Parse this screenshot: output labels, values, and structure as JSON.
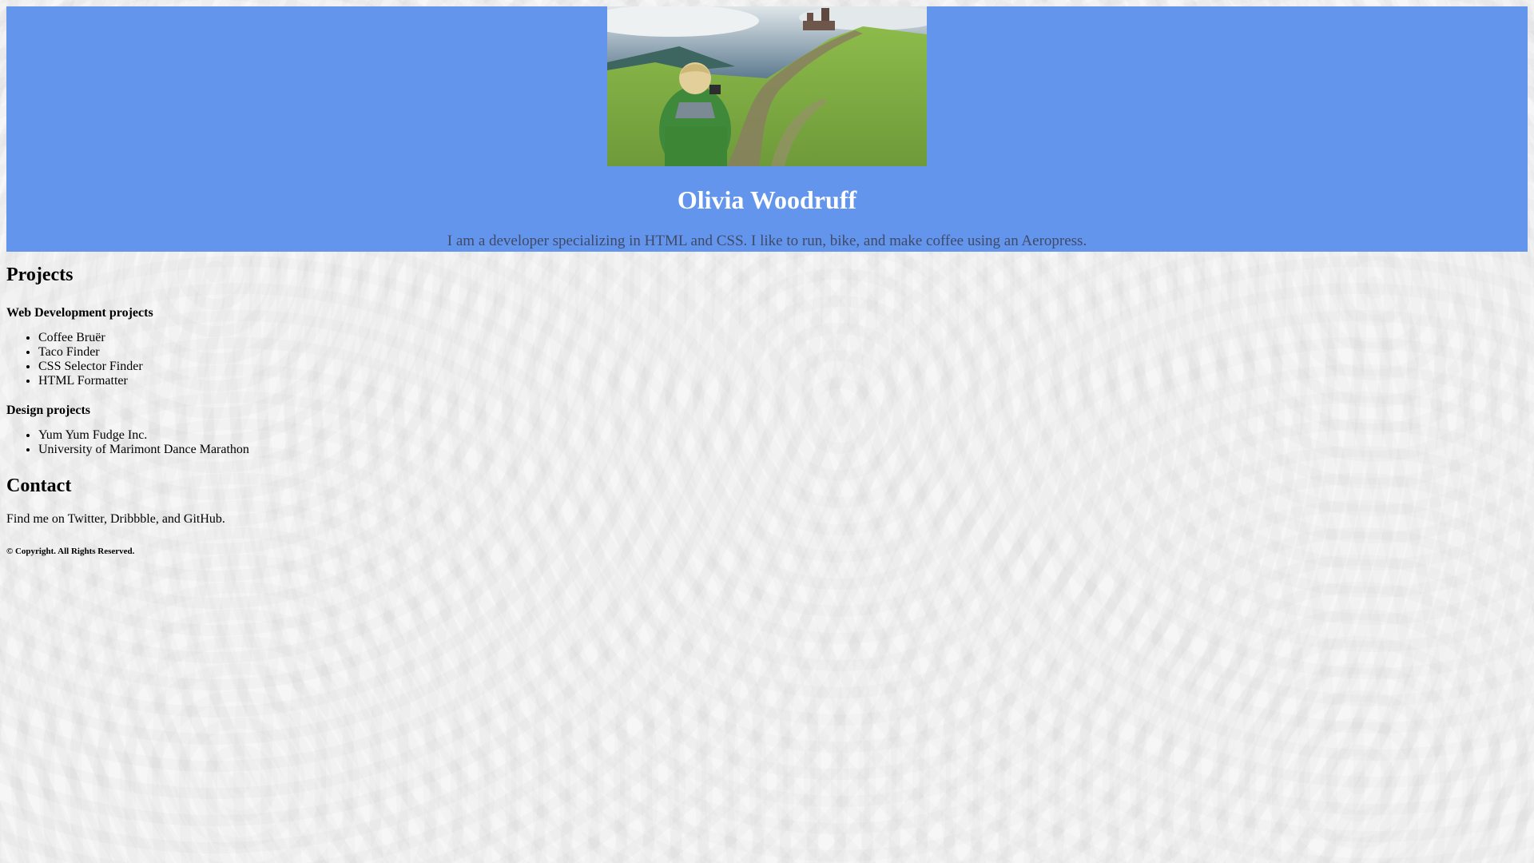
{
  "header": {
    "photo_alt": "Woman photographing a green mountain landscape",
    "name": "Olivia Woodruff",
    "tagline": "I am a developer specializing in HTML and CSS. I like to run, bike, and make coffee using an Aeropress.",
    "background_color": "#6495ed"
  },
  "projects": {
    "title": "Projects",
    "web_heading": "Web Development projects",
    "web_items": [
      "Coffee Bruër",
      "Taco Finder",
      "CSS Selector Finder",
      "HTML Formatter"
    ],
    "design_heading": "Design projects",
    "design_items": [
      "Yum Yum Fudge Inc.",
      "University of Marimont Dance Marathon"
    ]
  },
  "contact": {
    "title": "Contact",
    "text": "Find me on Twitter, Dribbble, and GitHub."
  },
  "footer": {
    "copyright": "© Copyright. All Rights Reserved."
  }
}
